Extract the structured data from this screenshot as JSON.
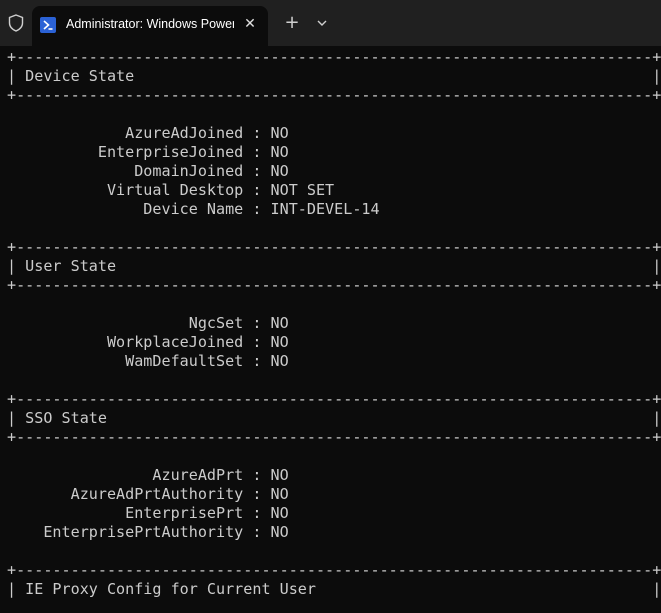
{
  "window": {
    "tab_title": "Administrator: Windows PowerShell",
    "close_glyph": "✕",
    "new_tab_glyph": "+"
  },
  "terminal": {
    "lines": [
      "+----------------------------------------------------------------------+",
      "| Device State                                                         |",
      "+----------------------------------------------------------------------+",
      "",
      "",
      "             AzureAdJoined : NO",
      "          EnterpriseJoined : NO",
      "              DomainJoined : NO",
      "           Virtual Desktop : NOT SET",
      "               Device Name : INT-DEVEL-14",
      "",
      "+----------------------------------------------------------------------+",
      "| User State                                                           |",
      "+----------------------------------------------------------------------+",
      "",
      "",
      "                    NgcSet : NO",
      "           WorkplaceJoined : NO",
      "             WamDefaultSet : NO",
      "",
      "+----------------------------------------------------------------------+",
      "| SSO State                                                            |",
      "+----------------------------------------------------------------------+",
      "",
      "",
      "                AzureAdPrt : NO",
      "       AzureAdPrtAuthority : NO",
      "             EnterprisePrt : NO",
      "    EnterprisePrtAuthority : NO",
      "",
      "+----------------------------------------------------------------------+",
      "| IE Proxy Config for Current User                                     |"
    ]
  }
}
